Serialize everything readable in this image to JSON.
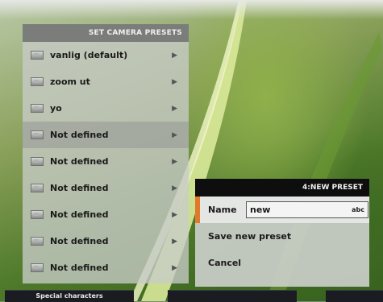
{
  "presets_panel": {
    "title": "SET CAMERA PRESETS",
    "items": [
      {
        "label": "vanlig (default)"
      },
      {
        "label": "zoom ut"
      },
      {
        "label": "yo"
      },
      {
        "label": "Not defined"
      },
      {
        "label": "Not defined"
      },
      {
        "label": "Not defined"
      },
      {
        "label": "Not defined"
      },
      {
        "label": "Not defined"
      },
      {
        "label": "Not defined"
      }
    ]
  },
  "new_preset_dialog": {
    "title": "4:NEW PRESET",
    "name_label": "Name",
    "name_value": "new",
    "input_mode": "abc",
    "save_label": "Save new preset",
    "cancel_label": "Cancel"
  },
  "softkeys": {
    "first": "Special characters"
  },
  "colors": {
    "accent": "#e07a2a",
    "header_dark": "#0e0e0e"
  }
}
